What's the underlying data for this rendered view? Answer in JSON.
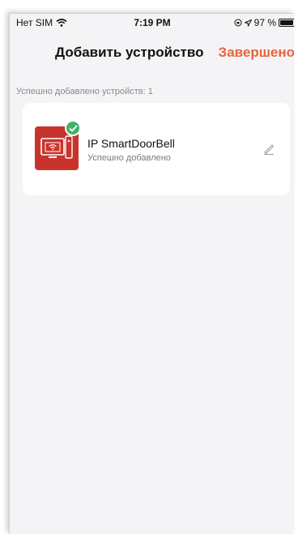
{
  "status_bar": {
    "carrier": "Нет SIM",
    "time": "7:19 PM",
    "battery": "97 %",
    "battery_level": 0.97
  },
  "header": {
    "title": "Добавить устройство",
    "done_label": "Завершено",
    "done_color": "#e8643c"
  },
  "section": {
    "label": "Успешно добавлено устройств: 1"
  },
  "device": {
    "name": "IP SmartDoorBell",
    "status": "Успешно добавлено",
    "icon_color": "#c8342c",
    "badge_color": "#3fb36b",
    "icon": "doorbell-monitor-icon"
  }
}
